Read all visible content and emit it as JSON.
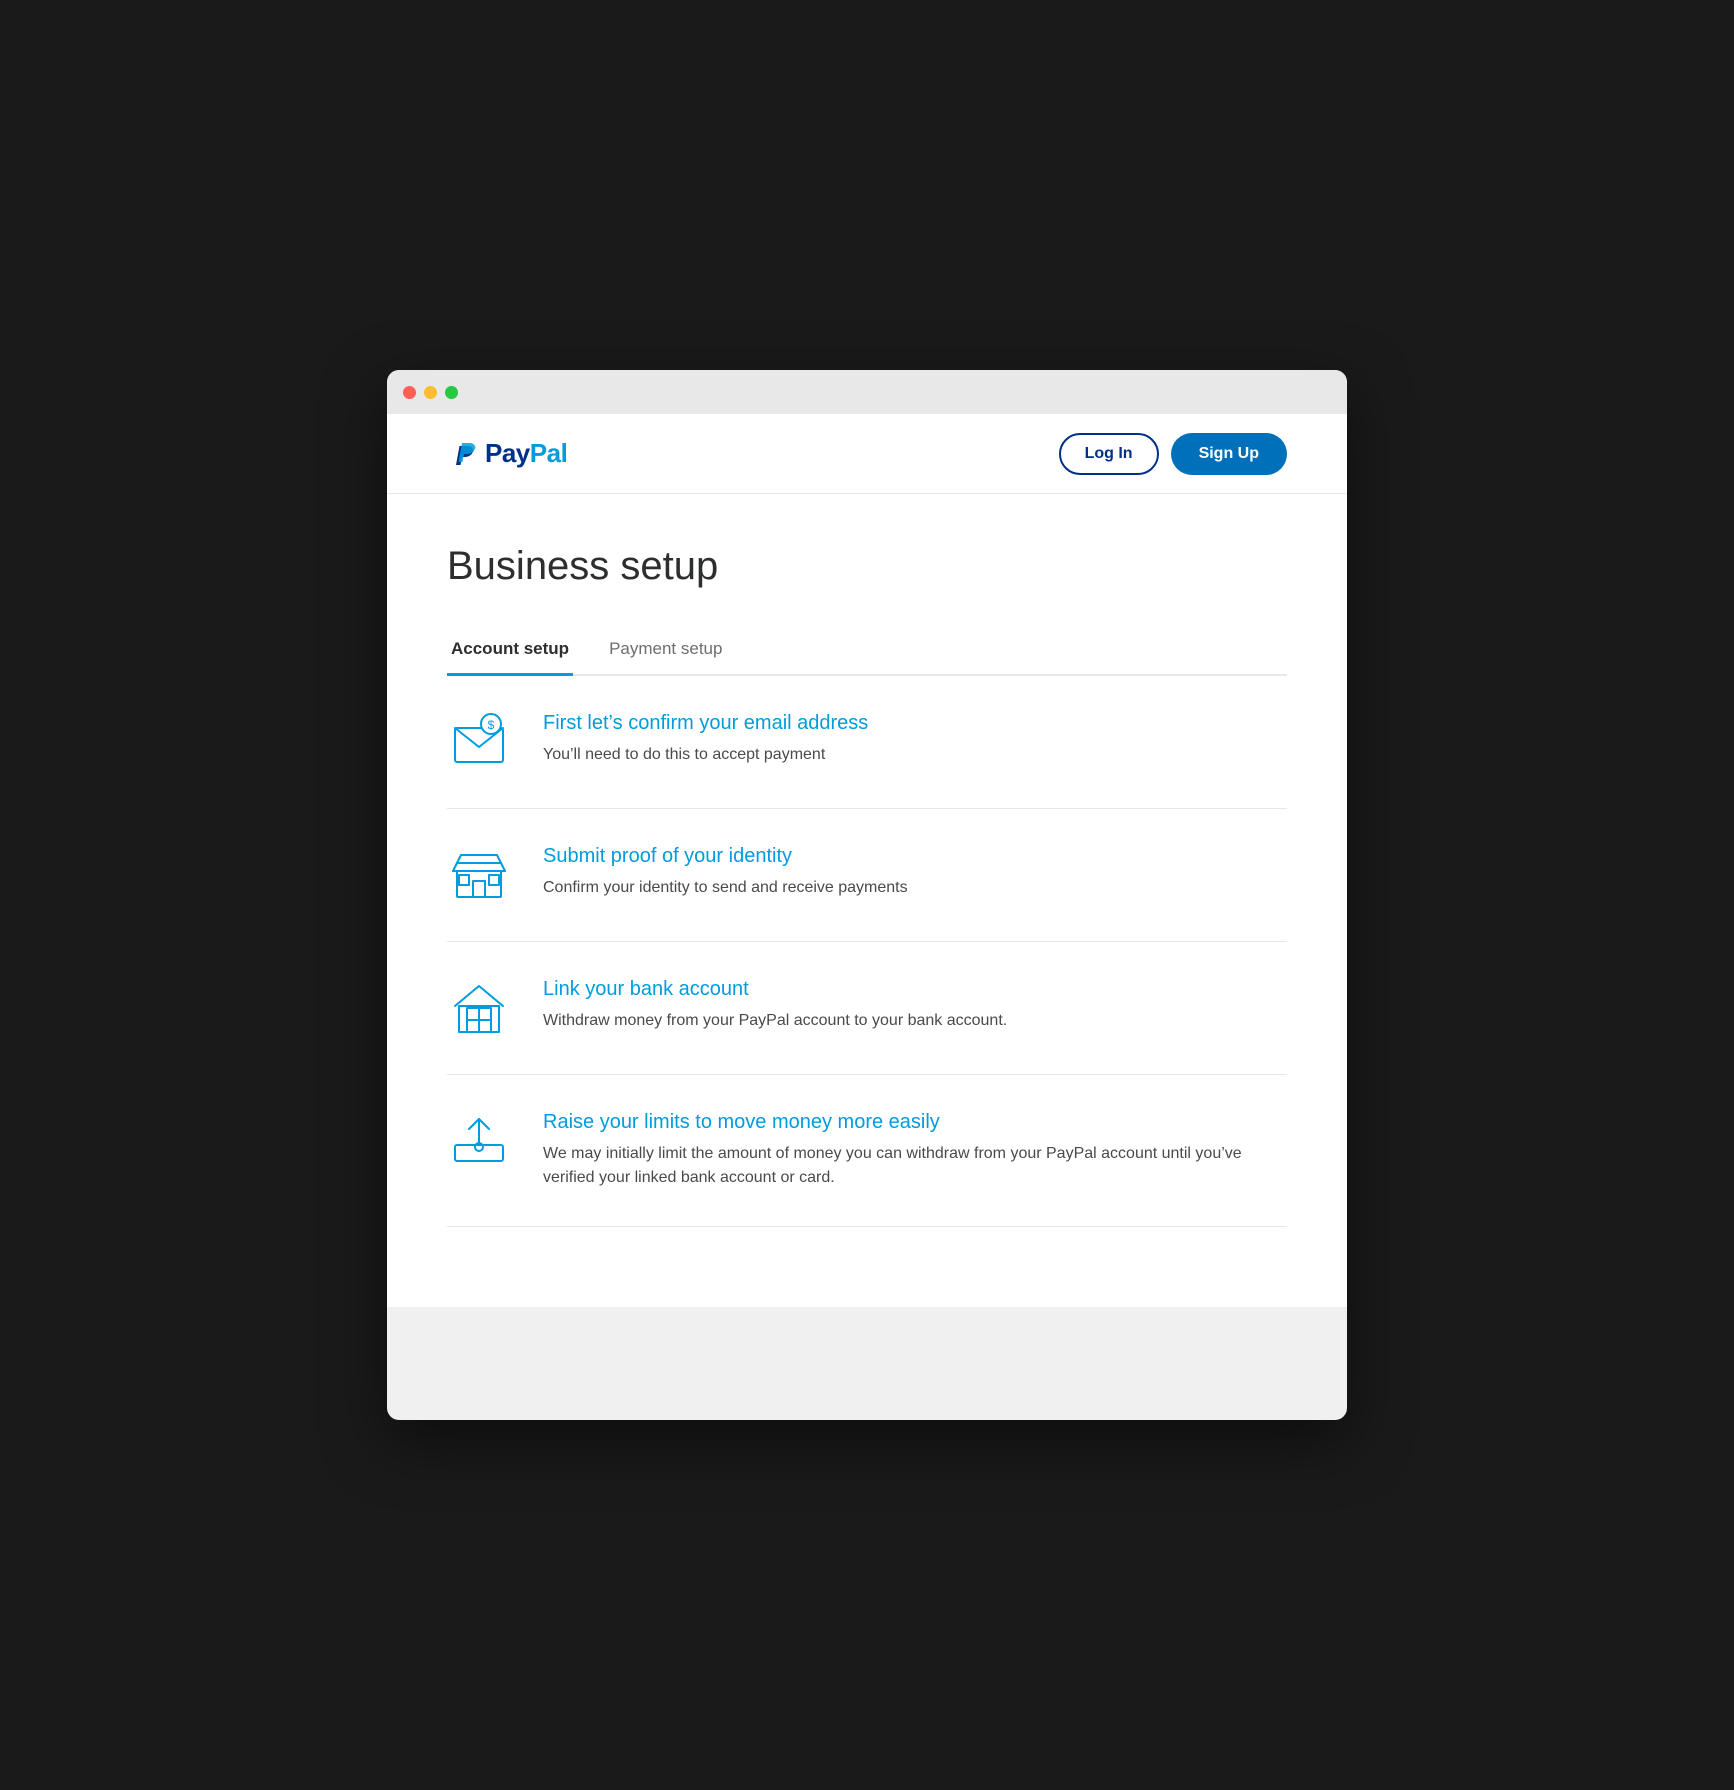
{
  "window": {
    "dots": [
      "red",
      "yellow",
      "green"
    ]
  },
  "navbar": {
    "logo_pay": "Pay",
    "logo_pal": "Pal",
    "login_label": "Log In",
    "signup_label": "Sign Up"
  },
  "main": {
    "page_title": "Business setup",
    "tabs": [
      {
        "label": "Account setup",
        "active": true
      },
      {
        "label": "Payment setup",
        "active": false
      }
    ],
    "setup_items": [
      {
        "icon": "email",
        "title": "First let’s confirm your email address",
        "description": "You’ll need to do this to accept payment"
      },
      {
        "icon": "store",
        "title": "Submit proof of your identity",
        "description": "Confirm your identity to send and receive payments"
      },
      {
        "icon": "bank",
        "title": "Link your bank account",
        "description": "Withdraw money from your PayPal account to your bank account."
      },
      {
        "icon": "upload",
        "title": "Raise your limits to move money more easily",
        "description": "We may initially limit the amount of money you can withdraw from your PayPal account until you’ve verified your linked bank account or card."
      }
    ]
  }
}
